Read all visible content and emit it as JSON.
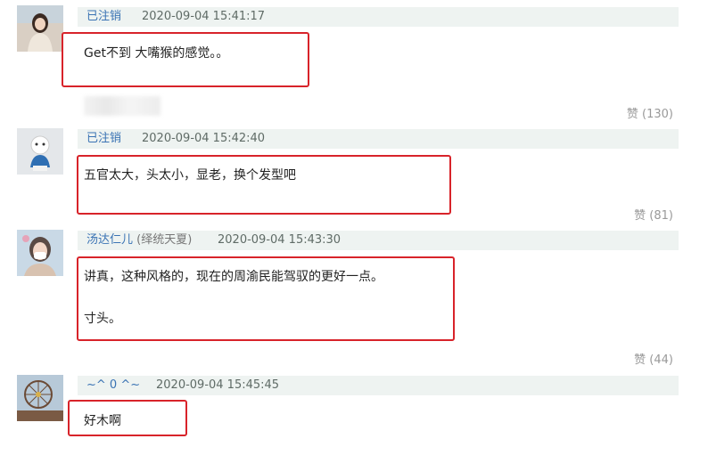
{
  "comments": [
    {
      "username": "已注销",
      "alias": "",
      "timestamp": "2020-09-04 15:41:17",
      "lines": [
        "Get不到 大嘴猴的感觉。。"
      ],
      "likes": "赞 (130)",
      "avatar_icon": "user-avatar-photo-woman"
    },
    {
      "username": "已注销",
      "alias": "",
      "timestamp": "2020-09-04 15:42:40",
      "lines": [
        "五官太大，头太小，显老，换个发型吧"
      ],
      "likes": "赞 (81)",
      "avatar_icon": "user-avatar-cartoon-figure"
    },
    {
      "username": "汤达仁儿",
      "alias": "(绎统天夏)",
      "timestamp": "2020-09-04 15:43:30",
      "lines": [
        "讲真，这种风格的，现在的周渝民能驾驭的更好一点。",
        "寸头。"
      ],
      "likes": "赞 (44)",
      "avatar_icon": "user-avatar-masked-person"
    },
    {
      "username": "~^ 0 ^~",
      "alias": "",
      "timestamp": "2020-09-04 15:45:45",
      "lines": [
        "好木啊"
      ],
      "likes": "",
      "avatar_icon": "user-avatar-ferris-wheel"
    }
  ],
  "colors": {
    "username": "#3a73b4",
    "header_bg": "#eef3f1",
    "highlight_box": "#d8232a",
    "likes": "#999999"
  }
}
